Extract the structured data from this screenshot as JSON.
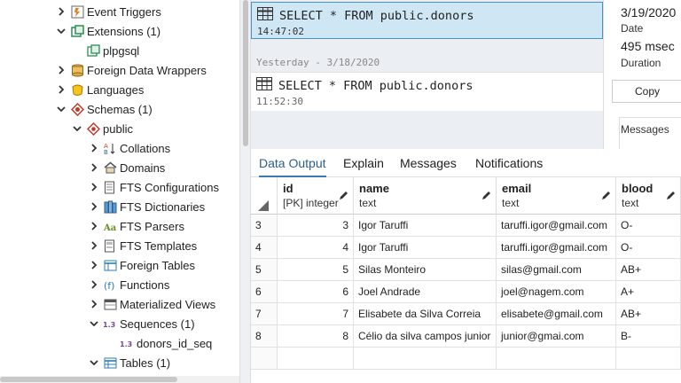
{
  "tree": {
    "items": [
      {
        "label": "Event Triggers",
        "icon": "event-trigger-icon",
        "chevron": "right"
      },
      {
        "label": "Extensions (1)",
        "icon": "extension-icon",
        "chevron": "down"
      },
      {
        "label": "plpgsql",
        "icon": "extension-item-icon",
        "chevron": "none"
      },
      {
        "label": "Foreign Data Wrappers",
        "icon": "foreign-data-wrapper-icon",
        "chevron": "right"
      },
      {
        "label": "Languages",
        "icon": "language-icon",
        "chevron": "right"
      },
      {
        "label": "Schemas (1)",
        "icon": "schemas-icon",
        "chevron": "down"
      },
      {
        "label": "public",
        "icon": "schema-icon",
        "chevron": "down"
      },
      {
        "label": "Collations",
        "icon": "collation-icon",
        "chevron": "right"
      },
      {
        "label": "Domains",
        "icon": "domain-icon",
        "chevron": "right"
      },
      {
        "label": "FTS Configurations",
        "icon": "fts-configuration-icon",
        "chevron": "right"
      },
      {
        "label": "FTS Dictionaries",
        "icon": "fts-dictionary-icon",
        "chevron": "right"
      },
      {
        "label": "FTS Parsers",
        "icon": "fts-parser-icon",
        "chevron": "right"
      },
      {
        "label": "FTS Templates",
        "icon": "fts-template-icon",
        "chevron": "right"
      },
      {
        "label": "Foreign Tables",
        "icon": "foreign-table-icon",
        "chevron": "right"
      },
      {
        "label": "Functions",
        "icon": "function-icon",
        "chevron": "right"
      },
      {
        "label": "Materialized Views",
        "icon": "materialized-view-icon",
        "chevron": "right"
      },
      {
        "label": "Sequences (1)",
        "icon": "sequence-icon",
        "chevron": "down"
      },
      {
        "label": "donors_id_seq",
        "icon": "sequence-item-icon",
        "chevron": "none"
      },
      {
        "label": "Tables (1)",
        "icon": "table-icon",
        "chevron": "down"
      }
    ]
  },
  "history": {
    "entries": [
      {
        "query": "SELECT * FROM public.donors",
        "time": "14:47:02",
        "selected": true
      },
      {
        "query": "SELECT * FROM public.donors",
        "time": "11:52:30",
        "selected": false
      }
    ],
    "date_separator": "Yesterday - 3/18/2020"
  },
  "details": {
    "date_value": "3/19/2020",
    "date_key": "Date",
    "duration_value": "495 msec",
    "duration_key": "Duration",
    "copy_label": "Copy",
    "messages_label": "Messages"
  },
  "output": {
    "tabs": [
      {
        "label": "Data Output",
        "active": true
      },
      {
        "label": "Explain",
        "active": false
      },
      {
        "label": "Messages",
        "active": false
      },
      {
        "label": "Notifications",
        "active": false
      }
    ],
    "columns": [
      {
        "name": "id",
        "type": "[PK] integer"
      },
      {
        "name": "name",
        "type": "text"
      },
      {
        "name": "email",
        "type": "text"
      },
      {
        "name": "blood",
        "type": "text"
      }
    ],
    "rows": [
      {
        "rownum": "3",
        "id": "3",
        "name": "Igor Taruffi",
        "email": "taruffi.igor@gmail.com",
        "blood": "O-"
      },
      {
        "rownum": "4",
        "id": "4",
        "name": "Igor Taruffi",
        "email": "taruffi.igor@gmail.com",
        "blood": "O-"
      },
      {
        "rownum": "5",
        "id": "5",
        "name": "Silas Monteiro",
        "email": "silas@gmail.com",
        "blood": "AB+"
      },
      {
        "rownum": "6",
        "id": "6",
        "name": "Joel Andrade",
        "email": "joel@nagem.com",
        "blood": "A+"
      },
      {
        "rownum": "7",
        "id": "7",
        "name": "Elisabete da Silva Correia",
        "email": "elisabete@gmail.com",
        "blood": "AB+"
      },
      {
        "rownum": "8",
        "id": "8",
        "name": "Célio da silva campos junior",
        "email": "junior@gmai.com",
        "blood": "B-"
      },
      {
        "rownum": "",
        "id": "",
        "name": "",
        "email": "",
        "blood": ""
      }
    ]
  }
}
